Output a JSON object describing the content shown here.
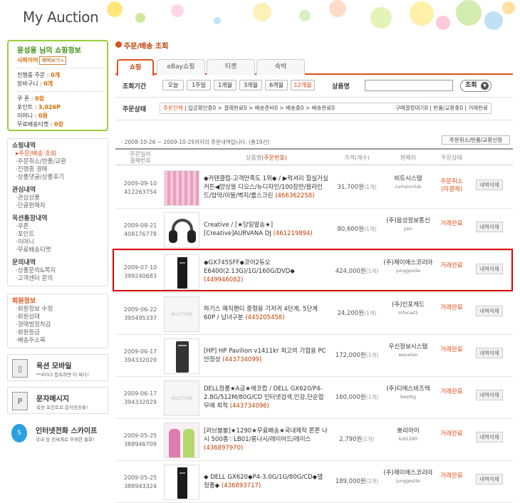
{
  "header": {
    "title": "My Auction"
  },
  "colors": {
    "accent": "#e0501b",
    "user_border": "#9ccf3a",
    "highlight": "#e00000"
  },
  "userbox": {
    "name_line": "윤성용 님의 쇼핑정보",
    "level": "사파이어",
    "level_button": "혜택보기>",
    "items1": [
      {
        "label": "진행중 주문 : ",
        "value": "0개"
      },
      {
        "label": "장바구니 : ",
        "value": "0개"
      }
    ],
    "items2": [
      {
        "label": "쿠 폰 : ",
        "value": "0장"
      },
      {
        "label": "포인트 : ",
        "value": "3,026P"
      },
      {
        "label": "이머니 : ",
        "value": "0원"
      },
      {
        "label": "무료배송티켓 : ",
        "value": "0장"
      }
    ]
  },
  "menu": {
    "groups": [
      {
        "title": "쇼핑내역",
        "items": [
          "주문/배송 조회",
          "주문취소/반품/교환",
          "진행중 경매",
          "상품댓글/상품후기"
        ]
      },
      {
        "title": "관심내역",
        "items": [
          "관심상품",
          "단골판매자"
        ]
      },
      {
        "title": "옥션통장내역",
        "items": [
          "쿠폰",
          "포인트",
          "이머니",
          "무료배송티켓"
        ]
      },
      {
        "title": "문의내역",
        "items": [
          "상품문의&쪽지",
          "고객센터 문의"
        ]
      }
    ],
    "member": {
      "title": "회원정보",
      "items": [
        "회원정보 수정",
        "회원상태",
        "경매범정차감",
        "회원등급",
        "배송주소록"
      ]
    }
  },
  "promos": [
    {
      "title": "옥션 모바일",
      "sub": "**4553 접속하면 더 싸다!",
      "icon": "mobile-icon"
    },
    {
      "title": "문자메시지",
      "sub": "옥션 포인트로 문자전송을!",
      "icon": "message-icon"
    },
    {
      "title": "인터넷전화 스카이프",
      "sub": "국내 및 전세계로 무제한 통화!",
      "icon": "skype-icon"
    }
  ],
  "main": {
    "section_title": "주문/배송 조회",
    "tabs": [
      "쇼핑",
      "eBay쇼핑",
      "티켓",
      "숙박"
    ],
    "period_label": "조회기간",
    "period_buttons": [
      "오늘",
      "1주일",
      "1개월",
      "3개월",
      "6개월",
      "12개월"
    ],
    "product_label": "상품명",
    "search_button": "조회",
    "status_label": "주문상태",
    "status_all": "주문전체",
    "status_text": " | 입금확인중0 > 결제완료0 > 배송준비0 > 배송중0 > 배송완료0",
    "status_right": "구매결정대기0 | 반품/교환중0 | 거래완료",
    "period_text": "· 2008-10-26 ~ 2009-10-25까지의 주문내역입니다. (총19건)",
    "cancel_button": "주문취소/반품/교환신청",
    "columns": {
      "date": "주문일자\n결제번호",
      "product": "상품명",
      "product_no": "(주문번호)",
      "price": "가격(개수)",
      "seller": "판매자",
      "status": "주문상태"
    },
    "detail_button": "내역삭제",
    "rows": [
      {
        "date": "2009-09-10",
        "no": "412263754",
        "name": "◆커텐클럽-고객만족도 1위◆ / ▶럭셔리 침실거실 커튼◀양상블 디오스/뉴디자인/100장만/블라인드/암막/이불/벽지/롤스크린",
        "order": "(466362258)",
        "price": "31,700원",
        "qty": "(1개)",
        "seller": "비트시스템",
        "seller_id": "curtainclub",
        "status": "주문취소\n(미결제)",
        "img": "curtain"
      },
      {
        "date": "2009-08-21",
        "no": "408176778",
        "name": "Creative / [★당일발송★][Creative]AURVANA DJ",
        "order": "(461219894)",
        "price": "80,600원",
        "qty": "(1개)",
        "seller": "(주)음성정보통신",
        "seller_id": "ysic",
        "status": "거래완료",
        "img": "headphone"
      },
      {
        "date": "2009-07-10",
        "no": "399240683",
        "name": "◆GX745SFF◆코어2듀오 E6400(2.13G)/1G/160G/DVD◆",
        "order": "(449946082)",
        "price": "424,000원",
        "qty": "(1개)",
        "seller": "(주)제이에스코리아",
        "seller_id": "junggosite",
        "status": "거래완료",
        "img": "pc"
      },
      {
        "date": "2009-06-22",
        "no": "395495337",
        "name": "하기스 매직팬티 중형용 기저귀 4단계, 5단계 60P / 남녀구분",
        "order": "(445205458)",
        "price": "24,200원",
        "qty": "(1개)",
        "seller": "(주)인포캐드",
        "seller_id": "infocad1",
        "status": "거래완료",
        "img": "auction"
      },
      {
        "date": "2009-06-17",
        "no": "394332029",
        "name": "[HP] HP Pavilion v1411kr 최고의 기업용 PC 안정성",
        "order": "(443734099)",
        "price": "172,000원",
        "qty": "(1개)",
        "seller": "우신정보시스템",
        "seller_id": "wavelan",
        "status": "거래완료",
        "img": "hppc"
      },
      {
        "date": "2009-06-17",
        "no": "394332029",
        "name": "DELL정품★A급★에코컴 / DELL GX620/P4-2.8G/512M/80G/CD 인터넷검색,인강,단순업무에 최적",
        "order": "(443734096)",
        "price": "160,000원",
        "qty": "(1개)",
        "seller": "(주)티에스비즈텍",
        "seller_id": "bestkg",
        "status": "거래완료",
        "img": "auction"
      },
      {
        "date": "2009-05-25",
        "no": "388946709",
        "name": "[러브붐붐]★1290★무료배송★국내제작 쫀쫀 나시 500종♡LB01/롱나시/레이어드/레이스",
        "order": "(436897970)",
        "price": "2,790원",
        "qty": "(1개)",
        "seller": "뽀리아이",
        "seller_id": "kid1290",
        "status": "거래완료",
        "img": "clothes"
      },
      {
        "date": "2009-05-25",
        "no": "388943324",
        "name": "◆ DELL GX620◆P4-3.0G/1G/80G/CD◆델 정품◆",
        "order": "(436893717)",
        "price": "189,000원",
        "qty": "(1개)",
        "seller": "(주)제이에스코리아",
        "seller_id": "junggosite",
        "status": "거래완료",
        "img": "pc"
      }
    ]
  }
}
